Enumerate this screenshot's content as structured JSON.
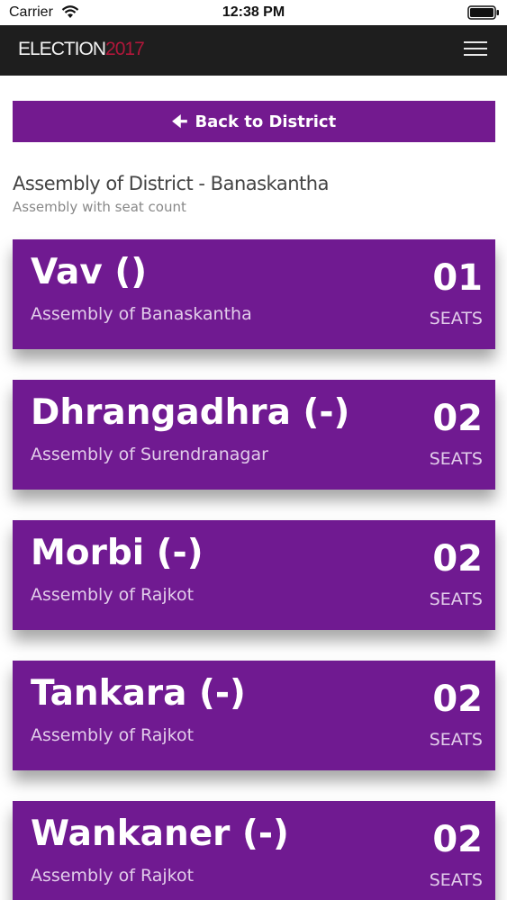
{
  "status_bar": {
    "carrier": "Carrier",
    "time": "12:38 PM",
    "wifi_icon": "wifi-icon",
    "battery_icon": "battery-icon"
  },
  "header": {
    "brand_part1": "ELECTION",
    "brand_part2": "2017",
    "menu_icon": "hamburger-menu-icon"
  },
  "colors": {
    "accent": "#731a8f",
    "header_bg": "#1e1e1e",
    "brand_red": "#b0173a"
  },
  "back_button": {
    "icon": "arrow-left-icon",
    "label": "Back to District"
  },
  "section": {
    "title": "Assembly of District - Banaskantha",
    "subtitle": "Assembly with seat count"
  },
  "assemblies": [
    {
      "name": "Vav ()",
      "district": "Assembly of Banaskantha",
      "seats": "01",
      "unit": "SEATS"
    },
    {
      "name": "Dhrangadhra (-)",
      "district": "Assembly of Surendranagar",
      "seats": "02",
      "unit": "SEATS"
    },
    {
      "name": "Morbi (-)",
      "district": "Assembly of Rajkot",
      "seats": "02",
      "unit": "SEATS"
    },
    {
      "name": "Tankara (-)",
      "district": "Assembly of Rajkot",
      "seats": "02",
      "unit": "SEATS"
    },
    {
      "name": "Wankaner (-)",
      "district": "Assembly of Rajkot",
      "seats": "02",
      "unit": "SEATS"
    }
  ]
}
